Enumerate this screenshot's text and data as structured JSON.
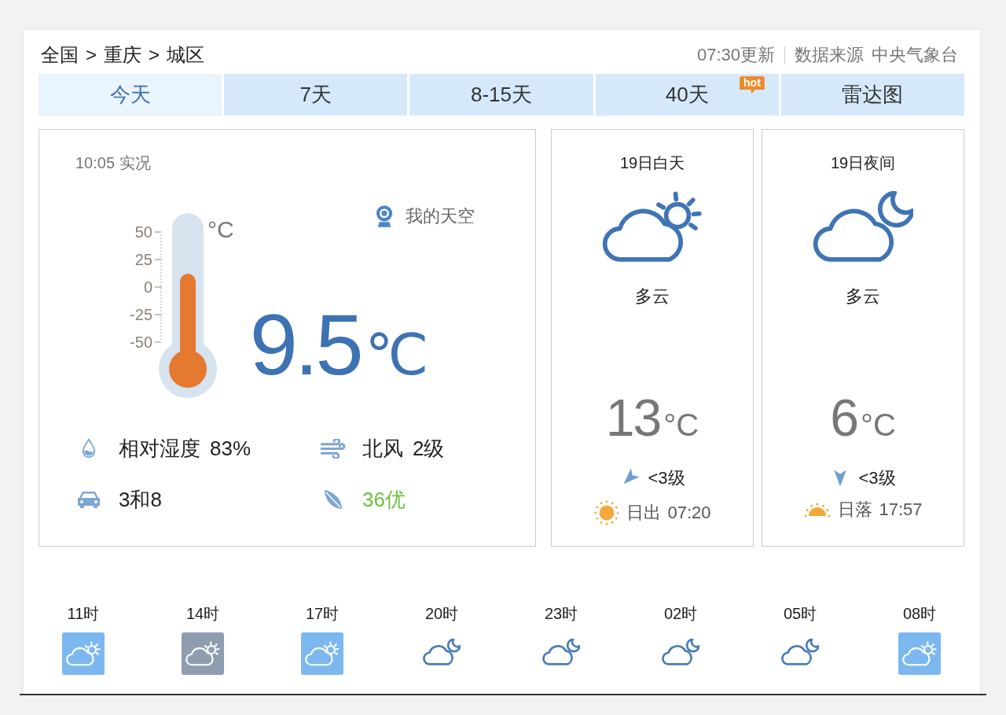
{
  "breadcrumb": [
    {
      "text": "全国"
    },
    {
      "separator": ">",
      "text": "重庆"
    },
    {
      "separator": ">",
      "text": "城区"
    }
  ],
  "update_info": {
    "updated": "07:30更新",
    "source_label": "数据来源",
    "source": "中央气象台"
  },
  "tabs": [
    {
      "label": "今天",
      "selected": true
    },
    {
      "label": "7天",
      "selected": false
    },
    {
      "label": "8-15天",
      "selected": false
    },
    {
      "label": "40天",
      "selected": false,
      "badge": "hot"
    },
    {
      "label": "雷达图",
      "selected": false
    }
  ],
  "current": {
    "time": "10:05",
    "label": "实况",
    "my_sky": "我的天空",
    "thermometer": {
      "ticks": [
        "50",
        "25",
        "0",
        "-25",
        "-50"
      ],
      "unit": "°C",
      "level": 0.52
    },
    "temperature": "9.5",
    "unit": "℃",
    "stats": [
      {
        "kind": "humidity",
        "label": "相对湿度",
        "value": "83%"
      },
      {
        "kind": "wind",
        "label": "北风",
        "value": "2级"
      },
      {
        "kind": "traffic",
        "value": "3和8"
      },
      {
        "kind": "air_quality",
        "value": "36优",
        "color": "#6cbf3f"
      }
    ]
  },
  "periods": [
    {
      "kind": "day",
      "title": "19日白天",
      "condition": "多云",
      "temperature": "13",
      "unit": "°C",
      "wind": "<3级",
      "sun_label": "日出",
      "sun_time": "07:20"
    },
    {
      "kind": "night",
      "title": "19日夜间",
      "condition": "多云",
      "temperature": "6",
      "unit": "°C",
      "wind": "<3级",
      "sun_label": "日落",
      "sun_time": "17:57"
    }
  ],
  "hourly": [
    {
      "time": "11时",
      "kind": "day",
      "color": "#7cb8ef"
    },
    {
      "time": "14时",
      "kind": "day",
      "color": "#8f9db0"
    },
    {
      "time": "17时",
      "kind": "day",
      "color": "#7cb8ef"
    },
    {
      "time": "20时",
      "kind": "night"
    },
    {
      "time": "23时",
      "kind": "night"
    },
    {
      "time": "02时",
      "kind": "night"
    },
    {
      "time": "05时",
      "kind": "night"
    },
    {
      "time": "08时",
      "kind": "day",
      "color": "#7cb8ef"
    }
  ]
}
